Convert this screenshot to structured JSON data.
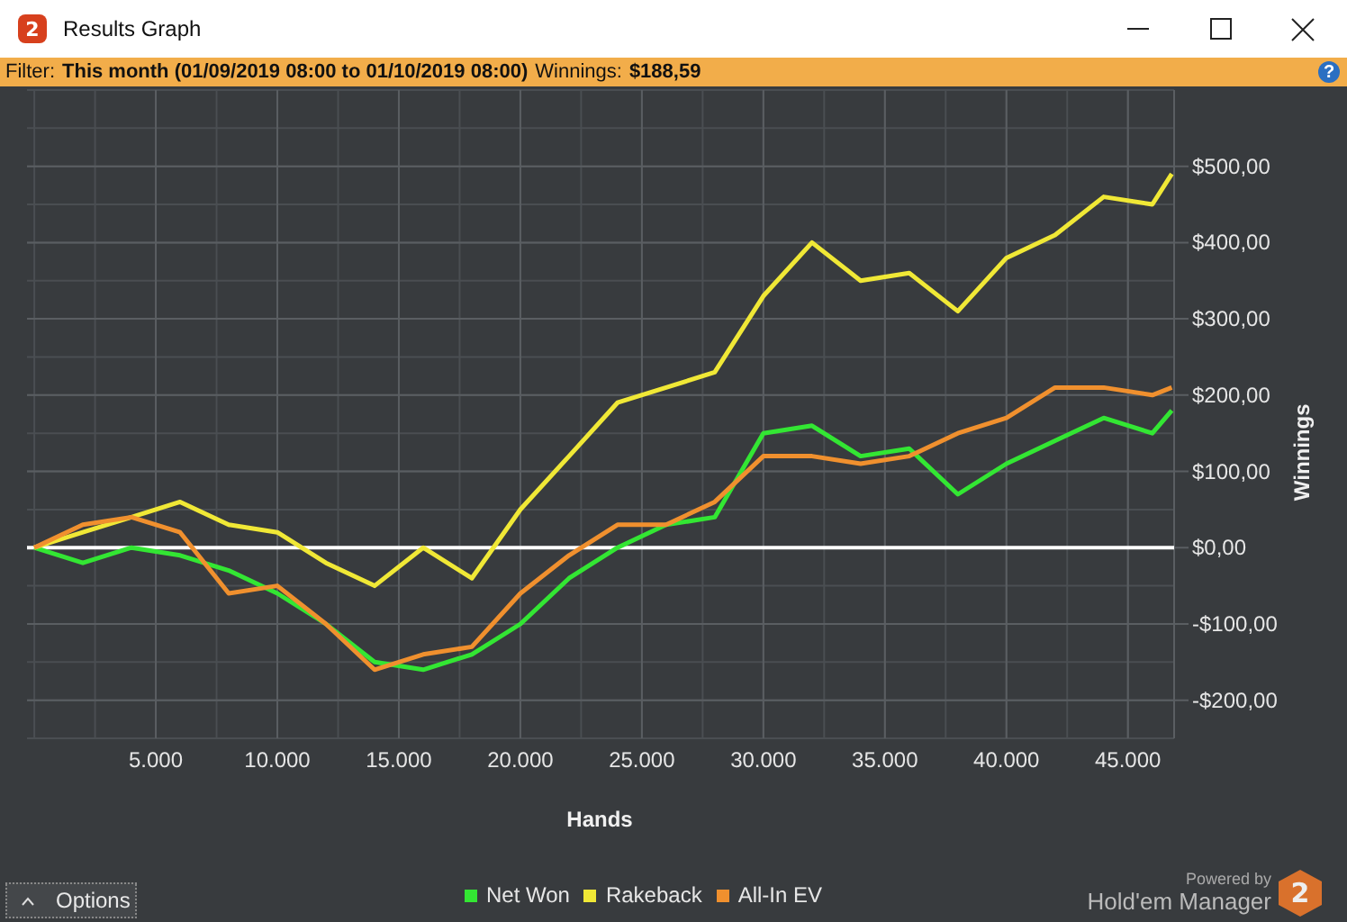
{
  "window": {
    "icon_label": "2",
    "title": "Results Graph"
  },
  "filter_bar": {
    "filter_label": "Filter:",
    "filter_value": "This month (01/09/2019 08:00 to 01/10/2019 08:00)",
    "winnings_label": "Winnings:",
    "winnings_value": "$188,59",
    "help_label": "?"
  },
  "chart_data": {
    "type": "line",
    "grid": true,
    "xlabel": "Hands",
    "ylabel": "Winnings",
    "xlim": [
      -300,
      46900
    ],
    "ylim": [
      -250,
      600
    ],
    "x": [
      0,
      2000,
      4000,
      6000,
      8000,
      10000,
      12000,
      14000,
      16000,
      18000,
      20000,
      22000,
      24000,
      26000,
      28000,
      30000,
      32000,
      34000,
      36000,
      38000,
      40000,
      42000,
      44000,
      46000,
      46800
    ],
    "xticks": [
      {
        "value": 5000,
        "label": "5.000"
      },
      {
        "value": 10000,
        "label": "10.000"
      },
      {
        "value": 15000,
        "label": "15.000"
      },
      {
        "value": 20000,
        "label": "20.000"
      },
      {
        "value": 25000,
        "label": "25.000"
      },
      {
        "value": 30000,
        "label": "30.000"
      },
      {
        "value": 35000,
        "label": "35.000"
      },
      {
        "value": 40000,
        "label": "40.000"
      },
      {
        "value": 45000,
        "label": "45.000"
      }
    ],
    "yticks": [
      {
        "value": -200,
        "label": "-$200,00"
      },
      {
        "value": -100,
        "label": "-$100,00"
      },
      {
        "value": 0,
        "label": "$0,00"
      },
      {
        "value": 100,
        "label": "$100,00"
      },
      {
        "value": 200,
        "label": "$200,00"
      },
      {
        "value": 300,
        "label": "$300,00"
      },
      {
        "value": 400,
        "label": "$400,00"
      },
      {
        "value": 500,
        "label": "$500,00"
      }
    ],
    "series": [
      {
        "name": "Net Won",
        "color": "#33e633",
        "values": [
          0,
          -20,
          0,
          -10,
          -30,
          -60,
          -100,
          -150,
          -160,
          -140,
          -100,
          -40,
          0,
          30,
          40,
          150,
          160,
          120,
          130,
          70,
          110,
          140,
          170,
          150,
          180
        ]
      },
      {
        "name": "Rakeback",
        "color": "#f0e836",
        "values": [
          0,
          20,
          40,
          60,
          30,
          20,
          -20,
          -50,
          0,
          -40,
          50,
          120,
          190,
          210,
          230,
          330,
          400,
          350,
          360,
          310,
          380,
          410,
          460,
          450,
          490
        ]
      },
      {
        "name": "All-In EV",
        "color": "#f0902e",
        "values": [
          0,
          30,
          40,
          20,
          -60,
          -50,
          -100,
          -160,
          -140,
          -130,
          -60,
          -10,
          30,
          30,
          60,
          120,
          120,
          110,
          120,
          150,
          170,
          210,
          210,
          200,
          210
        ]
      }
    ]
  },
  "options_button": {
    "label": "Options"
  },
  "branding": {
    "powered_by": "Powered by",
    "product": "Hold'em Manager",
    "logo_label": "2"
  }
}
